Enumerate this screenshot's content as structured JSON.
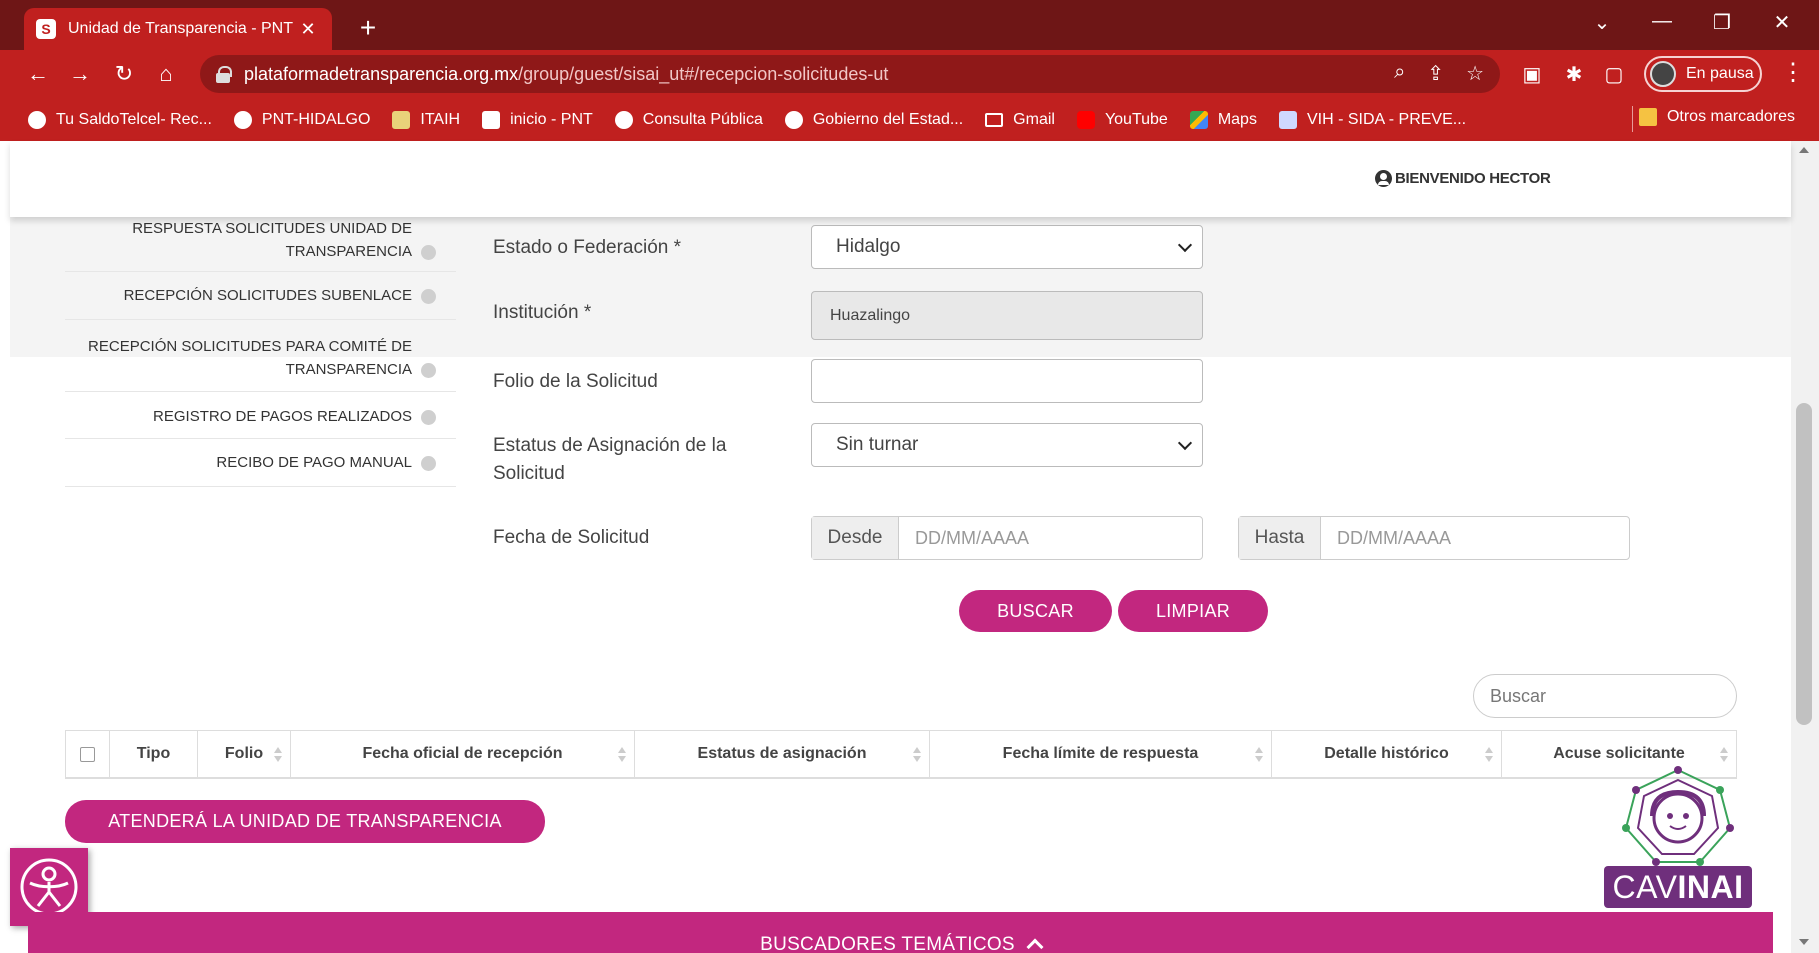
{
  "browser": {
    "tab_title": "Unidad de Transparencia - PNT",
    "tab_close": "✕",
    "new_tab": "+",
    "url_host": "plataformadetransparencia.org.mx",
    "url_path": "/group/guest/sisai_ut#/recepcion-solicitudes-ut",
    "profile_label": "En pausa",
    "bookmarks": [
      "Tu SaldoTelcel- Rec...",
      "PNT-HIDALGO",
      "ITAIH",
      "inicio - PNT",
      "Consulta Pública",
      "Gobierno del Estad...",
      "Gmail",
      "YouTube",
      "Maps",
      "VIH - SIDA - PREVE..."
    ],
    "other_bookmarks": "Otros marcadores"
  },
  "header": {
    "welcome": "BIENVENIDO HECTOR"
  },
  "sidenav": {
    "items": [
      "RESPUESTA SOLICITUDES UNIDAD DE TRANSPARENCIA",
      "RECEPCIÓN SOLICITUDES SUBENLACE",
      "RECEPCIÓN SOLICITUDES PARA COMITÉ DE TRANSPARENCIA",
      "REGISTRO DE PAGOS REALIZADOS",
      "RECIBO DE PAGO MANUAL"
    ],
    "item0_line1": "RESPUESTA SOLICITUDES UNIDAD DE",
    "item0_line2": "TRANSPARENCIA",
    "item2_line1": "RECEPCIÓN SOLICITUDES PARA COMITÉ DE",
    "item2_line2": "TRANSPARENCIA"
  },
  "form": {
    "estado_label": "Estado o Federación *",
    "estado_value": "Hidalgo",
    "institucion_label": "Institución *",
    "institucion_value": "Huazalingo",
    "folio_label": "Folio de la Solicitud",
    "folio_value": "",
    "estatus_label_line1": "Estatus de Asignación de la",
    "estatus_label_line2": "Solicitud",
    "estatus_value": "Sin turnar",
    "fecha_label": "Fecha de Solicitud",
    "desde_label": "Desde",
    "desde_placeholder": "DD/MM/AAAA",
    "hasta_label": "Hasta",
    "hasta_placeholder": "DD/MM/AAAA",
    "buscar_button": "BUSCAR",
    "limpiar_button": "LIMPIAR"
  },
  "table": {
    "search_placeholder": "Buscar",
    "columns": [
      "Tipo",
      "Folio",
      "Fecha oficial de recepción",
      "Estatus de asignación",
      "Fecha límite de respuesta",
      "Detalle histórico",
      "Acuse solicitante"
    ]
  },
  "actions": {
    "atendera_button": "ATENDERÁ LA UNIDAD DE TRANSPARENCIA"
  },
  "cavinai": {
    "label_light": "CAV",
    "label_bold": "INAI"
  },
  "footer": {
    "buscadores": "BUSCADORES TEMÁTICOS"
  },
  "colors": {
    "chrome_red": "#c0201f",
    "accent_magenta": "#c2277f",
    "cavinai_purple": "#6f2f7c"
  }
}
